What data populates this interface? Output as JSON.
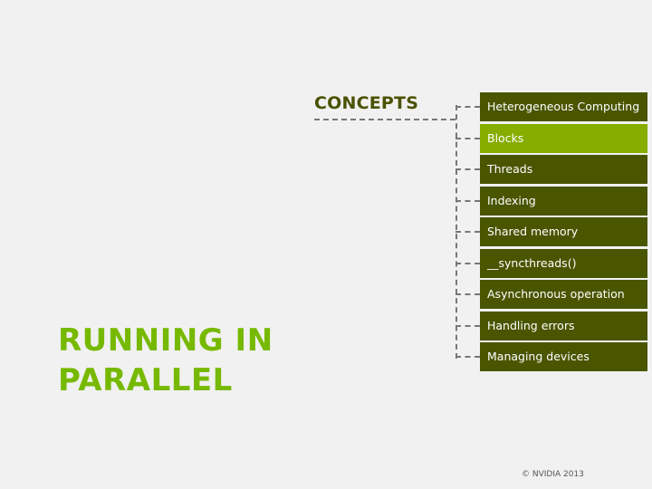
{
  "section_label": "CONCEPTS",
  "title_lines": [
    "RUNNING IN",
    "PARALLEL"
  ],
  "items": [
    {
      "label": "Heterogeneous Computing",
      "active": false
    },
    {
      "label": "Blocks",
      "active": true
    },
    {
      "label": "Threads",
      "active": false
    },
    {
      "label": "Indexing",
      "active": false
    },
    {
      "label": "Shared memory",
      "active": false
    },
    {
      "label": "__syncthreads()",
      "active": false
    },
    {
      "label": "Asynchronous operation",
      "active": false
    },
    {
      "label": "Handling errors",
      "active": false
    },
    {
      "label": "Managing devices",
      "active": false
    }
  ],
  "colors": {
    "item_bg": "#4a5500",
    "active_bg": "#86ad00",
    "title": "#76b900",
    "section": "#4a5200"
  },
  "footer": "© NVIDIA 2013"
}
